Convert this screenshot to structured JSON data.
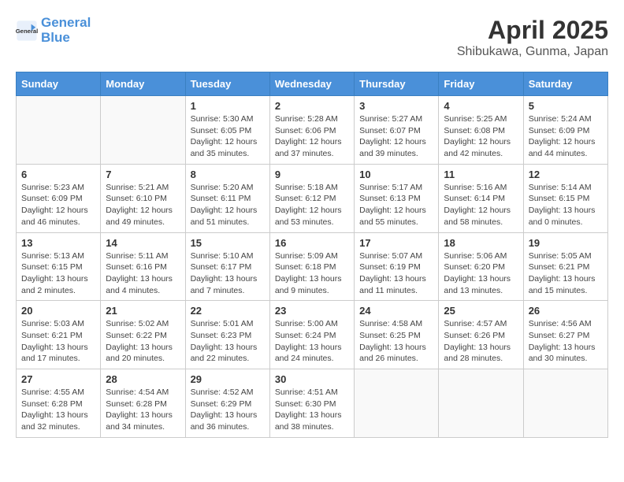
{
  "logo": {
    "line1": "General",
    "line2": "Blue"
  },
  "title": "April 2025",
  "location": "Shibukawa, Gunma, Japan",
  "weekdays": [
    "Sunday",
    "Monday",
    "Tuesday",
    "Wednesday",
    "Thursday",
    "Friday",
    "Saturday"
  ],
  "weeks": [
    [
      {
        "day": "",
        "info": ""
      },
      {
        "day": "",
        "info": ""
      },
      {
        "day": "1",
        "info": "Sunrise: 5:30 AM\nSunset: 6:05 PM\nDaylight: 12 hours and 35 minutes."
      },
      {
        "day": "2",
        "info": "Sunrise: 5:28 AM\nSunset: 6:06 PM\nDaylight: 12 hours and 37 minutes."
      },
      {
        "day": "3",
        "info": "Sunrise: 5:27 AM\nSunset: 6:07 PM\nDaylight: 12 hours and 39 minutes."
      },
      {
        "day": "4",
        "info": "Sunrise: 5:25 AM\nSunset: 6:08 PM\nDaylight: 12 hours and 42 minutes."
      },
      {
        "day": "5",
        "info": "Sunrise: 5:24 AM\nSunset: 6:09 PM\nDaylight: 12 hours and 44 minutes."
      }
    ],
    [
      {
        "day": "6",
        "info": "Sunrise: 5:23 AM\nSunset: 6:09 PM\nDaylight: 12 hours and 46 minutes."
      },
      {
        "day": "7",
        "info": "Sunrise: 5:21 AM\nSunset: 6:10 PM\nDaylight: 12 hours and 49 minutes."
      },
      {
        "day": "8",
        "info": "Sunrise: 5:20 AM\nSunset: 6:11 PM\nDaylight: 12 hours and 51 minutes."
      },
      {
        "day": "9",
        "info": "Sunrise: 5:18 AM\nSunset: 6:12 PM\nDaylight: 12 hours and 53 minutes."
      },
      {
        "day": "10",
        "info": "Sunrise: 5:17 AM\nSunset: 6:13 PM\nDaylight: 12 hours and 55 minutes."
      },
      {
        "day": "11",
        "info": "Sunrise: 5:16 AM\nSunset: 6:14 PM\nDaylight: 12 hours and 58 minutes."
      },
      {
        "day": "12",
        "info": "Sunrise: 5:14 AM\nSunset: 6:15 PM\nDaylight: 13 hours and 0 minutes."
      }
    ],
    [
      {
        "day": "13",
        "info": "Sunrise: 5:13 AM\nSunset: 6:15 PM\nDaylight: 13 hours and 2 minutes."
      },
      {
        "day": "14",
        "info": "Sunrise: 5:11 AM\nSunset: 6:16 PM\nDaylight: 13 hours and 4 minutes."
      },
      {
        "day": "15",
        "info": "Sunrise: 5:10 AM\nSunset: 6:17 PM\nDaylight: 13 hours and 7 minutes."
      },
      {
        "day": "16",
        "info": "Sunrise: 5:09 AM\nSunset: 6:18 PM\nDaylight: 13 hours and 9 minutes."
      },
      {
        "day": "17",
        "info": "Sunrise: 5:07 AM\nSunset: 6:19 PM\nDaylight: 13 hours and 11 minutes."
      },
      {
        "day": "18",
        "info": "Sunrise: 5:06 AM\nSunset: 6:20 PM\nDaylight: 13 hours and 13 minutes."
      },
      {
        "day": "19",
        "info": "Sunrise: 5:05 AM\nSunset: 6:21 PM\nDaylight: 13 hours and 15 minutes."
      }
    ],
    [
      {
        "day": "20",
        "info": "Sunrise: 5:03 AM\nSunset: 6:21 PM\nDaylight: 13 hours and 17 minutes."
      },
      {
        "day": "21",
        "info": "Sunrise: 5:02 AM\nSunset: 6:22 PM\nDaylight: 13 hours and 20 minutes."
      },
      {
        "day": "22",
        "info": "Sunrise: 5:01 AM\nSunset: 6:23 PM\nDaylight: 13 hours and 22 minutes."
      },
      {
        "day": "23",
        "info": "Sunrise: 5:00 AM\nSunset: 6:24 PM\nDaylight: 13 hours and 24 minutes."
      },
      {
        "day": "24",
        "info": "Sunrise: 4:58 AM\nSunset: 6:25 PM\nDaylight: 13 hours and 26 minutes."
      },
      {
        "day": "25",
        "info": "Sunrise: 4:57 AM\nSunset: 6:26 PM\nDaylight: 13 hours and 28 minutes."
      },
      {
        "day": "26",
        "info": "Sunrise: 4:56 AM\nSunset: 6:27 PM\nDaylight: 13 hours and 30 minutes."
      }
    ],
    [
      {
        "day": "27",
        "info": "Sunrise: 4:55 AM\nSunset: 6:28 PM\nDaylight: 13 hours and 32 minutes."
      },
      {
        "day": "28",
        "info": "Sunrise: 4:54 AM\nSunset: 6:28 PM\nDaylight: 13 hours and 34 minutes."
      },
      {
        "day": "29",
        "info": "Sunrise: 4:52 AM\nSunset: 6:29 PM\nDaylight: 13 hours and 36 minutes."
      },
      {
        "day": "30",
        "info": "Sunrise: 4:51 AM\nSunset: 6:30 PM\nDaylight: 13 hours and 38 minutes."
      },
      {
        "day": "",
        "info": ""
      },
      {
        "day": "",
        "info": ""
      },
      {
        "day": "",
        "info": ""
      }
    ]
  ]
}
